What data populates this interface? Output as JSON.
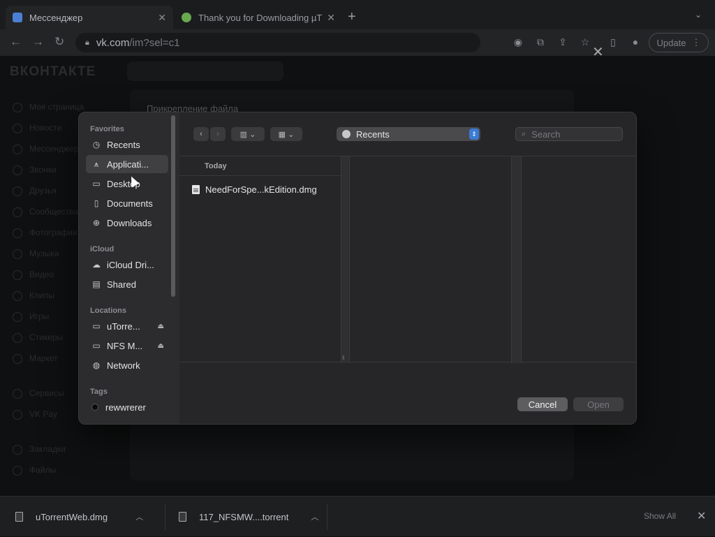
{
  "browser": {
    "tabs": [
      {
        "title": "Мессенджер",
        "active": true
      },
      {
        "title": "Thank you for Downloading µT",
        "active": false
      }
    ],
    "new_tab": "+",
    "tab_menu": "⌄",
    "url_host": "vk.com",
    "url_path": "/im?sel=c1",
    "update_label": "Update"
  },
  "vk": {
    "logo": "ВКОНТАКТЕ",
    "modal_title": "Прикрепление файла",
    "nav": [
      "Моя страница",
      "Новости",
      "Мессенджер",
      "Звонки",
      "Друзья",
      "Сообщества",
      "Фотографии",
      "Музыка",
      "Видео",
      "Клипы",
      "Игры",
      "Стикеры",
      "Маркет",
      "Сервисы",
      "VK Pay",
      "Закладки",
      "Файлы"
    ]
  },
  "dialog": {
    "sidebar": {
      "favorites_header": "Favorites",
      "favorites": [
        {
          "label": "Recents",
          "icon": "clock-icon",
          "glyph": "◷"
        },
        {
          "label": "Applicati...",
          "icon": "applications-icon",
          "glyph": "⩚",
          "selected": true
        },
        {
          "label": "Desktop",
          "icon": "desktop-icon",
          "glyph": "▭"
        },
        {
          "label": "Documents",
          "icon": "document-icon",
          "glyph": "▯"
        },
        {
          "label": "Downloads",
          "icon": "download-icon",
          "glyph": "⊕"
        }
      ],
      "icloud_header": "iCloud",
      "icloud": [
        {
          "label": "iCloud Dri...",
          "icon": "cloud-icon",
          "glyph": "☁"
        },
        {
          "label": "Shared",
          "icon": "shared-folder-icon",
          "glyph": "▤"
        }
      ],
      "locations_header": "Locations",
      "locations": [
        {
          "label": "uTorre...",
          "icon": "disk-icon",
          "glyph": "▭",
          "eject": "⏏"
        },
        {
          "label": "NFS M...",
          "icon": "disk-icon",
          "glyph": "▭",
          "eject": "⏏"
        },
        {
          "label": "Network",
          "icon": "network-icon",
          "glyph": "◍"
        }
      ],
      "tags_header": "Tags",
      "tags": [
        {
          "label": "rewwrerer"
        }
      ]
    },
    "toolbar": {
      "location": "Recents",
      "search_placeholder": "Search"
    },
    "column_header": "Today",
    "files": [
      {
        "name": "NeedForSpe...kEdition.dmg"
      }
    ],
    "cancel_label": "Cancel",
    "open_label": "Open"
  },
  "downloads": {
    "items": [
      {
        "name": "uTorrentWeb.dmg"
      },
      {
        "name": "117_NFSMW....torrent"
      }
    ],
    "show_all": "Show All"
  },
  "colors": {
    "accent": "#3a7bd5",
    "selection": "#404043"
  }
}
